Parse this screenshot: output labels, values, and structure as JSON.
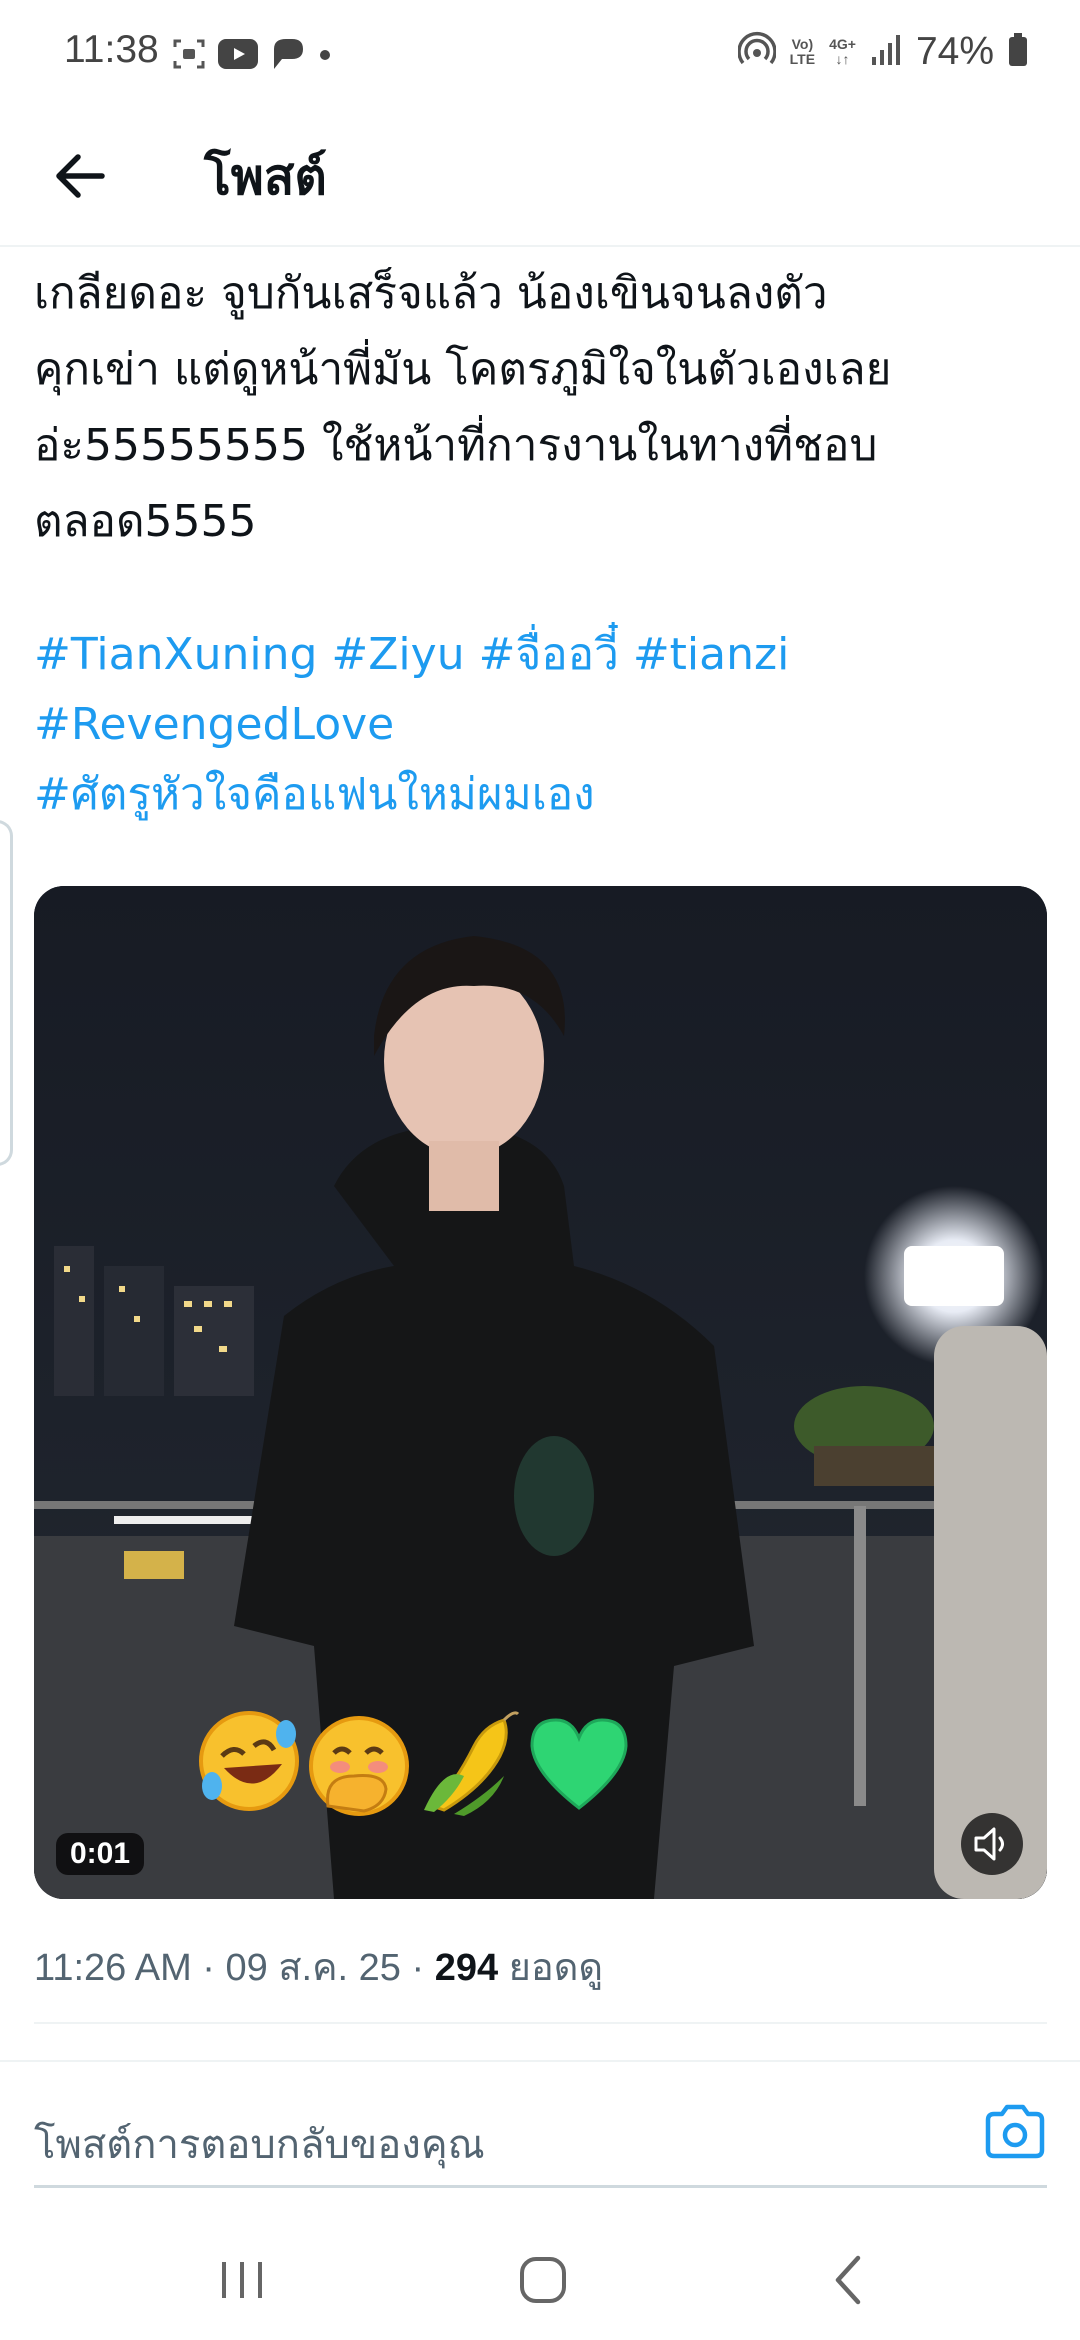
{
  "status_bar": {
    "time": "11:38",
    "battery": "74%",
    "network_label": "4G+",
    "volte_top": "Vo)",
    "volte_bottom": "LTE"
  },
  "header": {
    "title": "โพสต์"
  },
  "post": {
    "text": "เกลียดอะ จูบกันเสร็จแล้ว น้องเขินจนลงตัว\nคุกเข่า แต่ดูหน้าพี่มัน โคตรภูมิใจในตัวเองเลย\nอ่ะ55555555 ใช้หน้าที่การงานในทางที่ชอบ\nตลอด5555",
    "hashtags": [
      "#TianXuning",
      "#Ziyu",
      "#จื่ออวี๋",
      "#tianzi",
      "#RevengedLove",
      "#ศัตรูหัวใจคือแฟนใหม่ผมเอง"
    ],
    "video": {
      "duration": "0:01",
      "emojis": [
        "rolling-laughing-emoji",
        "hand-over-mouth-emoji",
        "corn-emoji",
        "green-heart-emoji"
      ]
    },
    "meta": {
      "time": "11:26 AM",
      "date": "09 ส.ค. 25",
      "views_count": "294",
      "views_label": "ยอดดู"
    }
  },
  "reply": {
    "placeholder": "โพสต์การตอบกลับของคุณ"
  },
  "colors": {
    "accent": "#1d9bf0",
    "text": "#0f1419",
    "muted": "#536471"
  }
}
